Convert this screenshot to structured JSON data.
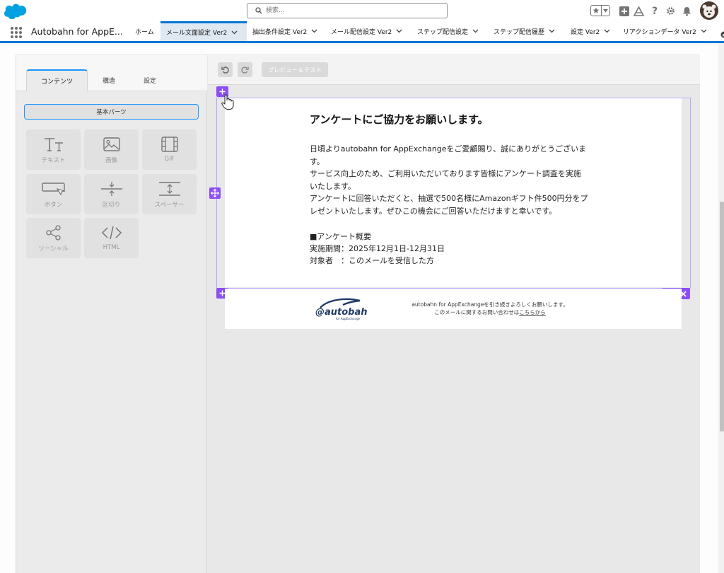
{
  "header": {
    "search_placeholder": "検索..."
  },
  "nav": {
    "app_name": "Autobahn for AppE...",
    "tabs": [
      {
        "label": "ホーム",
        "has_menu": false
      },
      {
        "label": "メール文面設定 Ver2",
        "has_menu": true,
        "active": true
      },
      {
        "label": "抽出条件設定 Ver2",
        "has_menu": true
      },
      {
        "label": "メール配信設定 Ver2",
        "has_menu": true
      },
      {
        "label": "ステップ配信設定",
        "has_menu": true
      },
      {
        "label": "ステップ配信履歴",
        "has_menu": true
      },
      {
        "label": "設定 Ver2",
        "has_menu": true
      },
      {
        "label": "リアクションデータ Ver2",
        "has_menu": true
      }
    ]
  },
  "editor": {
    "panel_tabs": [
      "コンテンツ",
      "構造",
      "設定"
    ],
    "basic_parts_label": "基本パーツ",
    "blocks": [
      {
        "icon": "text-icon",
        "label": "テキスト"
      },
      {
        "icon": "image-icon",
        "label": "画像"
      },
      {
        "icon": "gif-icon",
        "label": "GIF"
      },
      {
        "icon": "button-icon",
        "label": "ボタン"
      },
      {
        "icon": "divider-icon",
        "label": "区切り"
      },
      {
        "icon": "spacer-icon",
        "label": "スペーサー"
      },
      {
        "icon": "social-icon",
        "label": "ソーシャル"
      },
      {
        "icon": "html-icon",
        "label": "HTML"
      }
    ],
    "toolbar": {
      "preview_label": "プレビュー＆テスト"
    }
  },
  "email": {
    "title": "アンケートにご協力をお願いします。",
    "body": [
      "日頃よりautobahn for AppExchangeをご愛顧賜り、誠にありがとうございま\nす。",
      "サービス向上のため、ご利用いただいております皆様にアンケート調査を実施\nいたします。",
      "アンケートに回答いただくと、抽選で500名様にAmazonギフト件500円分をプ\nレゼントいたします。ぜひこの機会にご回答いただけますと幸いです。"
    ],
    "summary": {
      "heading": "■アンケート概要",
      "period": "実施期間：2025年12月1日-12月31日",
      "target": "対象者　：このメールを受信した方"
    },
    "footer": {
      "logo_text": "@autobahn",
      "logo_subtext": "for AppExchange",
      "line1": "autobahn for AppExchangeを引き続きよろしくお願いします。",
      "line2_prefix": "このメールに関するお問い合わせは",
      "line2_link": "こちらから"
    }
  },
  "colors": {
    "brand_blue": "#0176d3",
    "selection_purple": "#8b4ff2",
    "salesforce_cloud": "#00a1e0"
  }
}
